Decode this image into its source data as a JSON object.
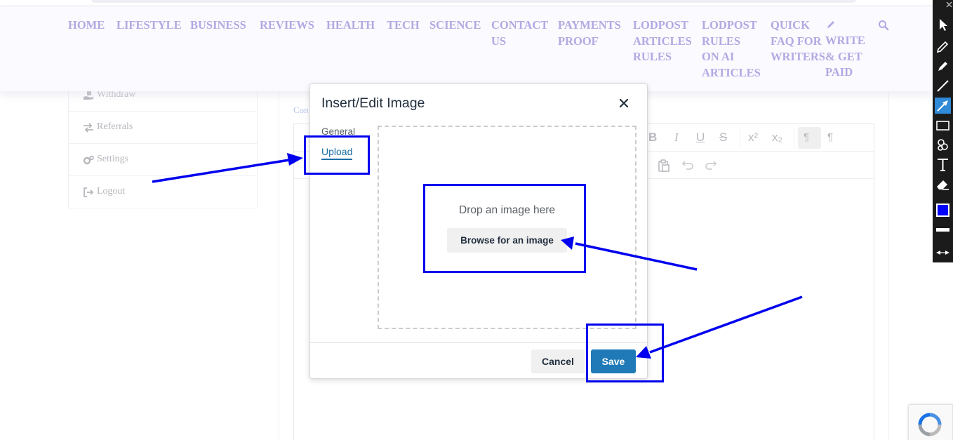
{
  "nav": {
    "items": [
      {
        "label": "HOME"
      },
      {
        "label": "LIFESTYLE"
      },
      {
        "label": "BUSINESS"
      },
      {
        "label": "REVIEWS"
      },
      {
        "label": "HEALTH"
      },
      {
        "label": "TECH"
      },
      {
        "label": "SCIENCE"
      },
      {
        "label": "CONTACT\nUS"
      },
      {
        "label": "PAYMENTS\nPROOF"
      },
      {
        "label": "LODPOST\nARTICLES\nRULES"
      },
      {
        "label": "LODPOST\nRULES\nON AI\nARTICLES"
      },
      {
        "label": "QUICK\nFAQ FOR\nWRITERS"
      },
      {
        "label": "WRITE\n& GET\nPAID",
        "icon": "pencil-icon"
      }
    ],
    "search_icon": "search-icon",
    "text_color": "#b2a9e2"
  },
  "sidebar": {
    "items": [
      {
        "label": "Withdraw",
        "icon": "hand-money-icon"
      },
      {
        "label": "Referrals",
        "icon": "exchange-icon"
      },
      {
        "label": "Settings",
        "icon": "cogs-icon"
      },
      {
        "label": "Logout",
        "icon": "logout-icon"
      }
    ]
  },
  "content": {
    "breadcrumb_fragment": "Con"
  },
  "dialog": {
    "title": "Insert/Edit Image",
    "tabs": [
      {
        "label": "General",
        "active": false
      },
      {
        "label": "Upload",
        "active": true
      }
    ],
    "dropzone_text": "Drop an image here",
    "browse_label": "Browse for an image",
    "cancel_label": "Cancel",
    "save_label": "Save",
    "save_color": "#207ab7"
  },
  "annotation": {
    "color": "#0000ee"
  },
  "draw_toolbar": {
    "tools": [
      "cursor-icon",
      "pencil-icon",
      "marker-icon",
      "line-icon",
      "arrow-icon",
      "rectangle-icon",
      "stamp-icon",
      "text-icon",
      "eraser-icon",
      "color-swatch-icon",
      "stroke-width-icon",
      "collapse-icon"
    ],
    "active_tool": "arrow-icon",
    "swatch_color": "#0000ff"
  }
}
